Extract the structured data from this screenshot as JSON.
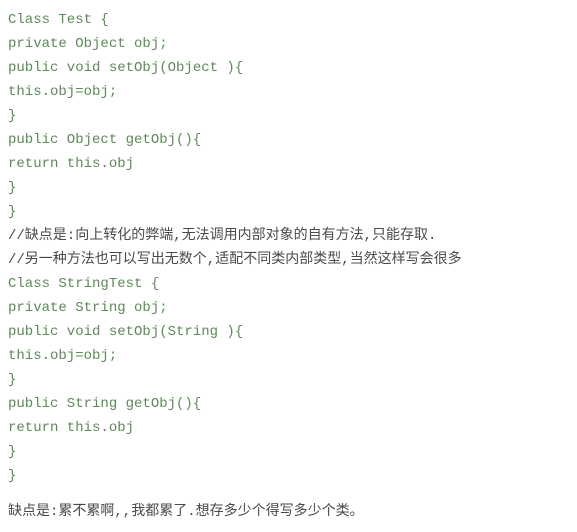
{
  "lines": [
    {
      "cls": "code-line",
      "text": "Class Test {"
    },
    {
      "cls": "code-line",
      "text": "private Object obj;"
    },
    {
      "cls": "code-line",
      "text": "public void setObj(Object ){"
    },
    {
      "cls": "code-line",
      "text": "this.obj=obj;"
    },
    {
      "cls": "code-line",
      "text": "}"
    },
    {
      "cls": "code-line",
      "text": "public Object getObj(){"
    },
    {
      "cls": "code-line",
      "text": "return this.obj"
    },
    {
      "cls": "code-line",
      "text": "}"
    },
    {
      "cls": "code-line",
      "text": "}"
    },
    {
      "cls": "comment-line",
      "text": "//缺点是:向上转化的弊端,无法调用内部对象的自有方法,只能存取."
    },
    {
      "cls": "comment-line",
      "text": "//另一种方法也可以写出无数个,适配不同类内部类型,当然这样写会很多"
    },
    {
      "cls": "code-line",
      "text": "Class StringTest {"
    },
    {
      "cls": "code-line",
      "text": "private String obj;"
    },
    {
      "cls": "code-line",
      "text": "public void setObj(String ){"
    },
    {
      "cls": "code-line",
      "text": "this.obj=obj;"
    },
    {
      "cls": "code-line",
      "text": "}"
    },
    {
      "cls": "code-line",
      "text": "public String getObj(){"
    },
    {
      "cls": "code-line",
      "text": "return this.obj"
    },
    {
      "cls": "code-line",
      "text": "}"
    },
    {
      "cls": "code-line",
      "text": "}"
    }
  ],
  "footer": "缺点是:累不累啊,,我都累了.想存多少个得写多少个类。"
}
